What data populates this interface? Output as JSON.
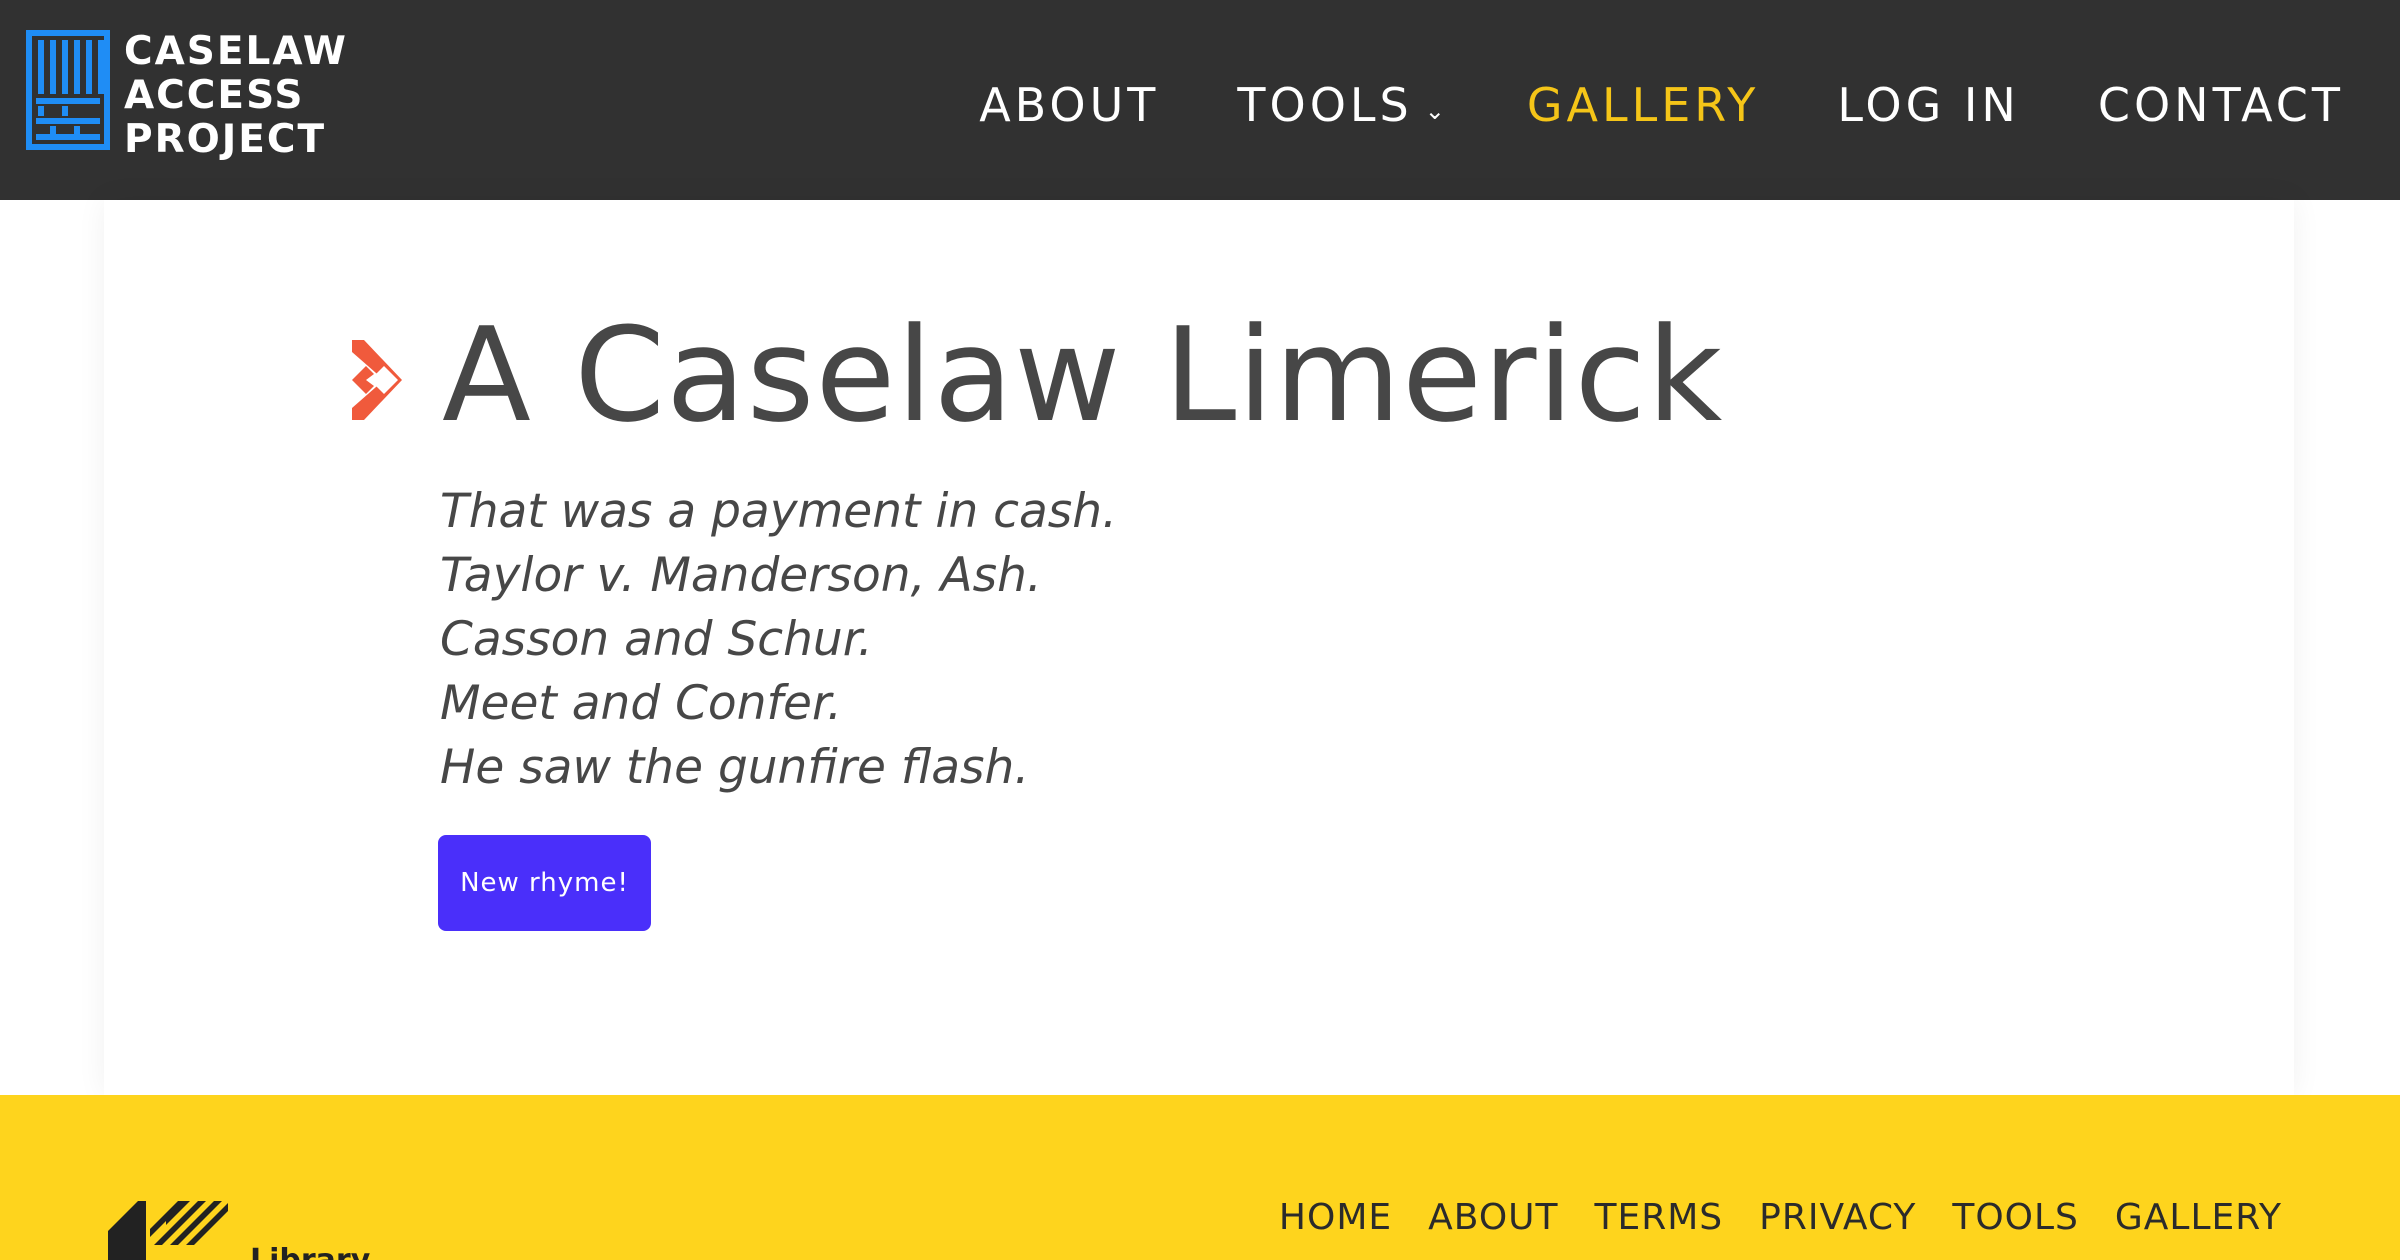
{
  "header": {
    "logo_lines": [
      "CASELAW",
      "ACCESS",
      "PROJECT"
    ],
    "nav": [
      {
        "label": "ABOUT",
        "active": false
      },
      {
        "label": "TOOLS",
        "active": false,
        "has_dropdown": true,
        "caret": "⌄"
      },
      {
        "label": "GALLERY",
        "active": true
      },
      {
        "label": "LOG IN",
        "active": false
      },
      {
        "label": "CONTACT",
        "active": false
      }
    ]
  },
  "main": {
    "title": "A Caselaw Limerick",
    "poem": [
      "That was a payment in cash.",
      "Taylor v. Manderson, Ash.",
      "Casson and Schur.",
      "Meet and Confer.",
      "He saw the gunfire flash."
    ],
    "button_label": "New rhyme!"
  },
  "footer": {
    "logo_text": "Library",
    "links": [
      "HOME",
      "ABOUT",
      "TERMS",
      "PRIVACY",
      "TOOLS",
      "GALLERY"
    ]
  },
  "colors": {
    "header_bg": "#313131",
    "logo_blue": "#1f8df5",
    "nav_active": "#f5c518",
    "title_text": "#474747",
    "accent_icon": "#f05a3c",
    "button_bg": "#4a2ffa",
    "footer_bg": "#fed41d"
  },
  "icons": {
    "logo": "cap-grid-logo-icon",
    "title_marker": "diamond-chevron-icon",
    "dropdown": "chevron-down-icon",
    "footer_logo": "library-logo-icon"
  }
}
